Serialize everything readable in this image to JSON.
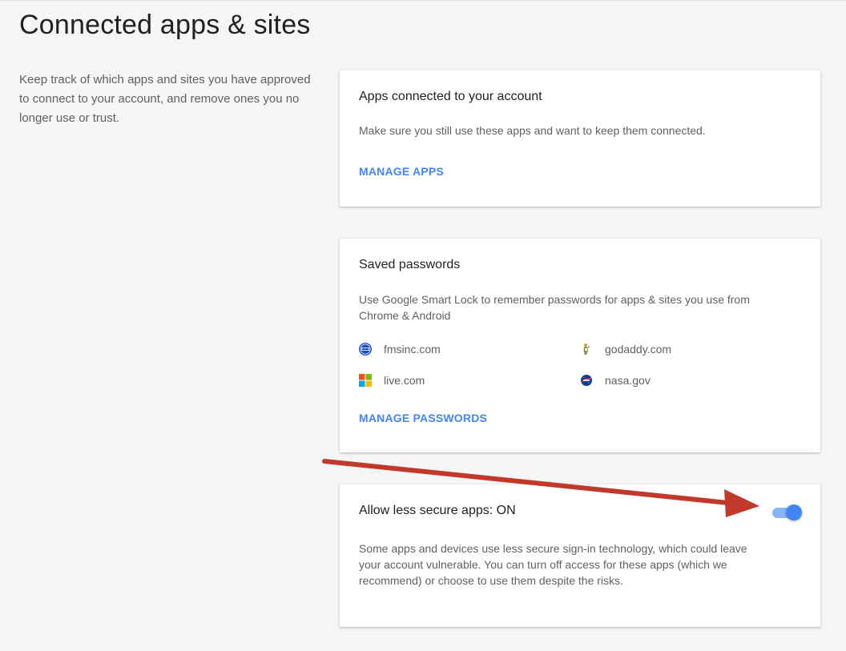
{
  "page": {
    "title": "Connected apps & sites",
    "description": "Keep track of which apps and sites you have approved to connect to your account, and remove ones you no longer use or trust."
  },
  "apps_card": {
    "title": "Apps connected to your account",
    "description": "Make sure you still use these apps and want to keep them connected.",
    "link": "MANAGE APPS"
  },
  "passwords_card": {
    "title": "Saved passwords",
    "description": "Use Google Smart Lock to remember passwords for apps & sites you use from Chrome & Android",
    "sites": [
      {
        "label": "fmsinc.com",
        "icon": "fms-logo-icon"
      },
      {
        "label": "godaddy.com",
        "icon": "godaddy-logo-icon"
      },
      {
        "label": "live.com",
        "icon": "microsoft-logo-icon"
      },
      {
        "label": "nasa.gov",
        "icon": "nasa-logo-icon"
      }
    ],
    "link": "MANAGE PASSWORDS"
  },
  "less_secure_card": {
    "title": "Allow less secure apps: ON",
    "description": "Some apps and devices use less secure sign-in technology, which could leave your account vulnerable. You can turn off access for these apps (which we recommend) or choose to use them despite the risks.",
    "toggle_on": true
  },
  "colors": {
    "accent": "#4285f4",
    "toggle_track": "#8ab4f8",
    "annotation_arrow": "#c0392b",
    "background": "#f5f5f5",
    "card": "#ffffff"
  }
}
